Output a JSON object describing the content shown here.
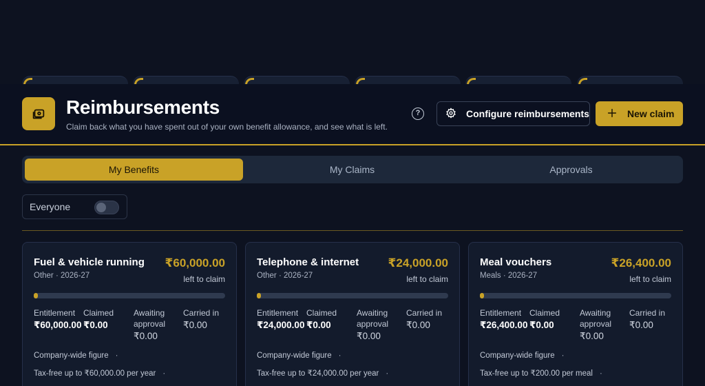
{
  "header": {
    "title": "Reimbursements",
    "subtitle": "Claim back what you have spent out of your own benefit allowance, and see what is left.",
    "configure_label": "Configure reimbursements",
    "new_claim_label": "New claim",
    "help_glyph": "?"
  },
  "tabs": [
    {
      "label": "My Benefits",
      "active": true
    },
    {
      "label": "My Claims",
      "active": false
    },
    {
      "label": "Approvals",
      "active": false
    }
  ],
  "filter": {
    "label": "Everyone",
    "toggle_on": false
  },
  "colors": {
    "accent": "#c9a227",
    "background": "#0d1220",
    "card": "#131b2c"
  },
  "stat_labels": {
    "entitlement": "Entitlement",
    "claimed": "Claimed",
    "awaiting": "Awaiting approval",
    "carried": "Carried in",
    "left": "left to claim",
    "company_wide": "Company-wide figure"
  },
  "cards": [
    {
      "name": "Fuel & vehicle running",
      "meta": "Other · 2026-27",
      "amount": "₹60,000.00",
      "progress_pct": 0,
      "entitlement": "₹60,000.00",
      "claimed": "₹0.00",
      "awaiting": "₹0.00",
      "carried": "₹0.00",
      "tax_note": "Tax-free up to ₹60,000.00 per year"
    },
    {
      "name": "Telephone & internet",
      "meta": "Other · 2026-27",
      "amount": "₹24,000.00",
      "progress_pct": 0,
      "entitlement": "₹24,000.00",
      "claimed": "₹0.00",
      "awaiting": "₹0.00",
      "carried": "₹0.00",
      "tax_note": "Tax-free up to ₹24,000.00 per year"
    },
    {
      "name": "Meal vouchers",
      "meta": "Meals · 2026-27",
      "amount": "₹26,400.00",
      "progress_pct": 0,
      "entitlement": "₹26,400.00",
      "claimed": "₹0.00",
      "awaiting": "₹0.00",
      "carried": "₹0.00",
      "tax_note": "Tax-free up to ₹200.00 per meal"
    }
  ],
  "icons": {
    "app": "wallet-icon",
    "help": "help-circle-icon",
    "configure": "gear-icon",
    "new": "plus-icon"
  }
}
